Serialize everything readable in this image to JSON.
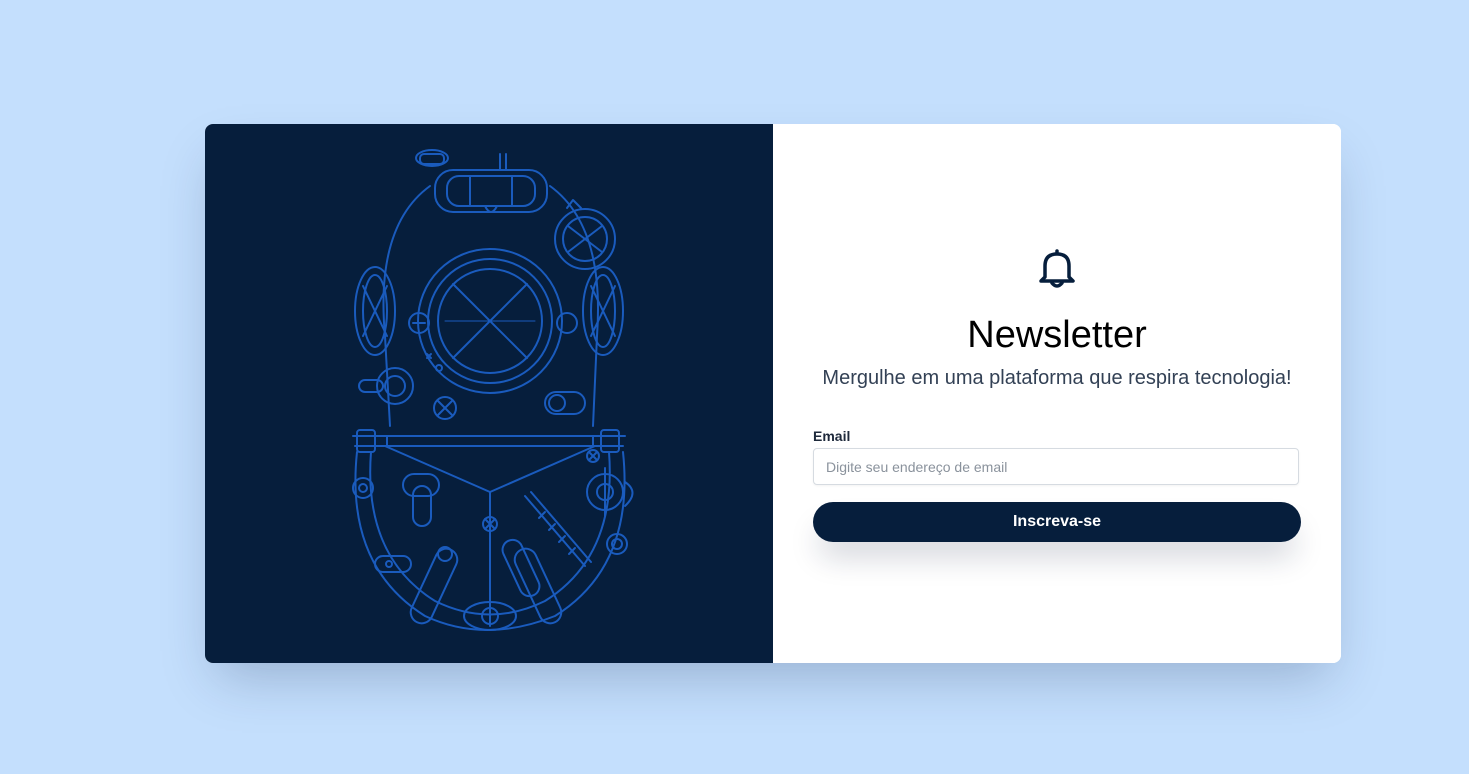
{
  "newsletter": {
    "icon": "bell-icon",
    "title": "Newsletter",
    "subtitle": "Mergulhe em uma plataforma que respira tecnologia!",
    "email_label": "Email",
    "email_placeholder": "Digite seu endereço de email",
    "email_value": "",
    "submit_label": "Inscreva-se"
  },
  "illustration": {
    "icon": "diving-helmet-illustration"
  },
  "colors": {
    "page_background": "#c4dffd",
    "art_background": "#061e3c",
    "art_line": "#1a5bbd",
    "button_background": "#061e3c",
    "button_text": "#ffffff"
  }
}
